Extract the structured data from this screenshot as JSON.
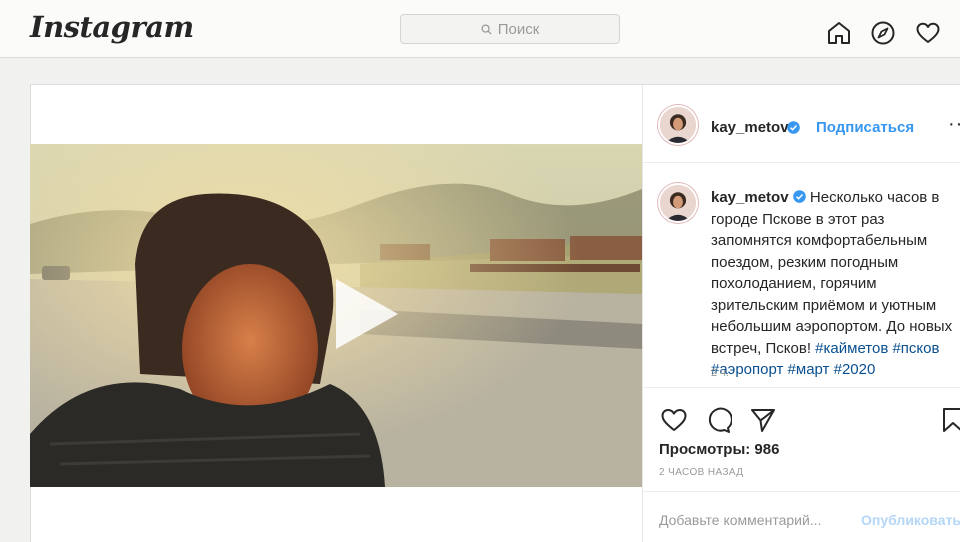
{
  "header": {
    "logo": "Instagram",
    "search_placeholder": "Поиск"
  },
  "nav": {
    "icons": [
      "home-icon",
      "explore-icon",
      "heart-icon"
    ]
  },
  "post": {
    "username": "kay_metov",
    "follow_label": "Подписаться",
    "more_label": "···",
    "caption_text": "Несколько часов в городе Пскове в этот раз запомнятся комфортабельным поездом, резким погодным похолоданием, горячим зрительским приёмом и уютным небольшим аэропортом. До новых встреч, Псков!",
    "hashtags": [
      "#кайметов",
      "#псков",
      "#аэропорт",
      "#март",
      "#2020"
    ],
    "caption_time": "2 ч.",
    "views": "Просмотры: 986",
    "posted_ago": "2 ЧАСОВ НАЗАД",
    "comment_placeholder": "Добавьте комментарий...",
    "publish_label": "Опубликовать"
  },
  "colors": {
    "link_blue": "#3897f0",
    "hashtag_blue": "#0a4f8f",
    "muted": "#9a9a9a"
  }
}
